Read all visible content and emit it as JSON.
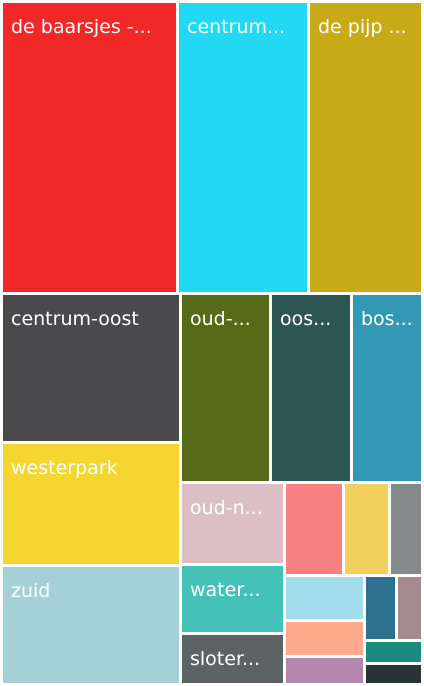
{
  "chart_data": {
    "type": "treemap",
    "tiles": [
      {
        "label": "de baarsjes -...",
        "color": "#f12828",
        "value": 15.9
      },
      {
        "label": "centrum...",
        "color": "#22d8f3",
        "value": 11.3
      },
      {
        "label": "de pijp ...",
        "color": "#c8aa16",
        "value": 9.7
      },
      {
        "label": "centrum-oost",
        "color": "#4a4a4c",
        "value": 7.9
      },
      {
        "label": "westerpark",
        "color": "#f5d631",
        "value": 6.2
      },
      {
        "label": "zuid",
        "color": "#a4d0d6",
        "value": 6.3
      },
      {
        "label": "oud-...",
        "color": "#556b17",
        "value": 4.6
      },
      {
        "label": "oos...",
        "color": "#2d5553",
        "value": 4.3
      },
      {
        "label": "bos...",
        "color": "#3398b4",
        "value": 4.3
      },
      {
        "label": "oud-n...",
        "color": "#dcbfc4",
        "value": 2.4
      },
      {
        "label": "water...",
        "color": "#45c2b7",
        "value": 1.6
      },
      {
        "label": "sloter...",
        "color": "#5b6462",
        "value": 1.4
      },
      {
        "label": "",
        "color": "#f88282",
        "value": 1.2
      },
      {
        "label": "",
        "color": "#f3d05e",
        "value": 1.1
      },
      {
        "label": "",
        "color": "#848a8b",
        "value": 0.8
      },
      {
        "label": "",
        "color": "#a3dbed",
        "value": 0.8
      },
      {
        "label": "",
        "color": "#fda98b",
        "value": 0.7
      },
      {
        "label": "",
        "color": "#b486ad",
        "value": 0.6
      },
      {
        "label": "",
        "color": "#2e7090",
        "value": 0.6
      },
      {
        "label": "",
        "color": "#a68b8c",
        "value": 0.6
      },
      {
        "label": "",
        "color": "#1a8b7f",
        "value": 0.3
      },
      {
        "label": "",
        "color": "#283437",
        "value": 0.4
      }
    ]
  }
}
